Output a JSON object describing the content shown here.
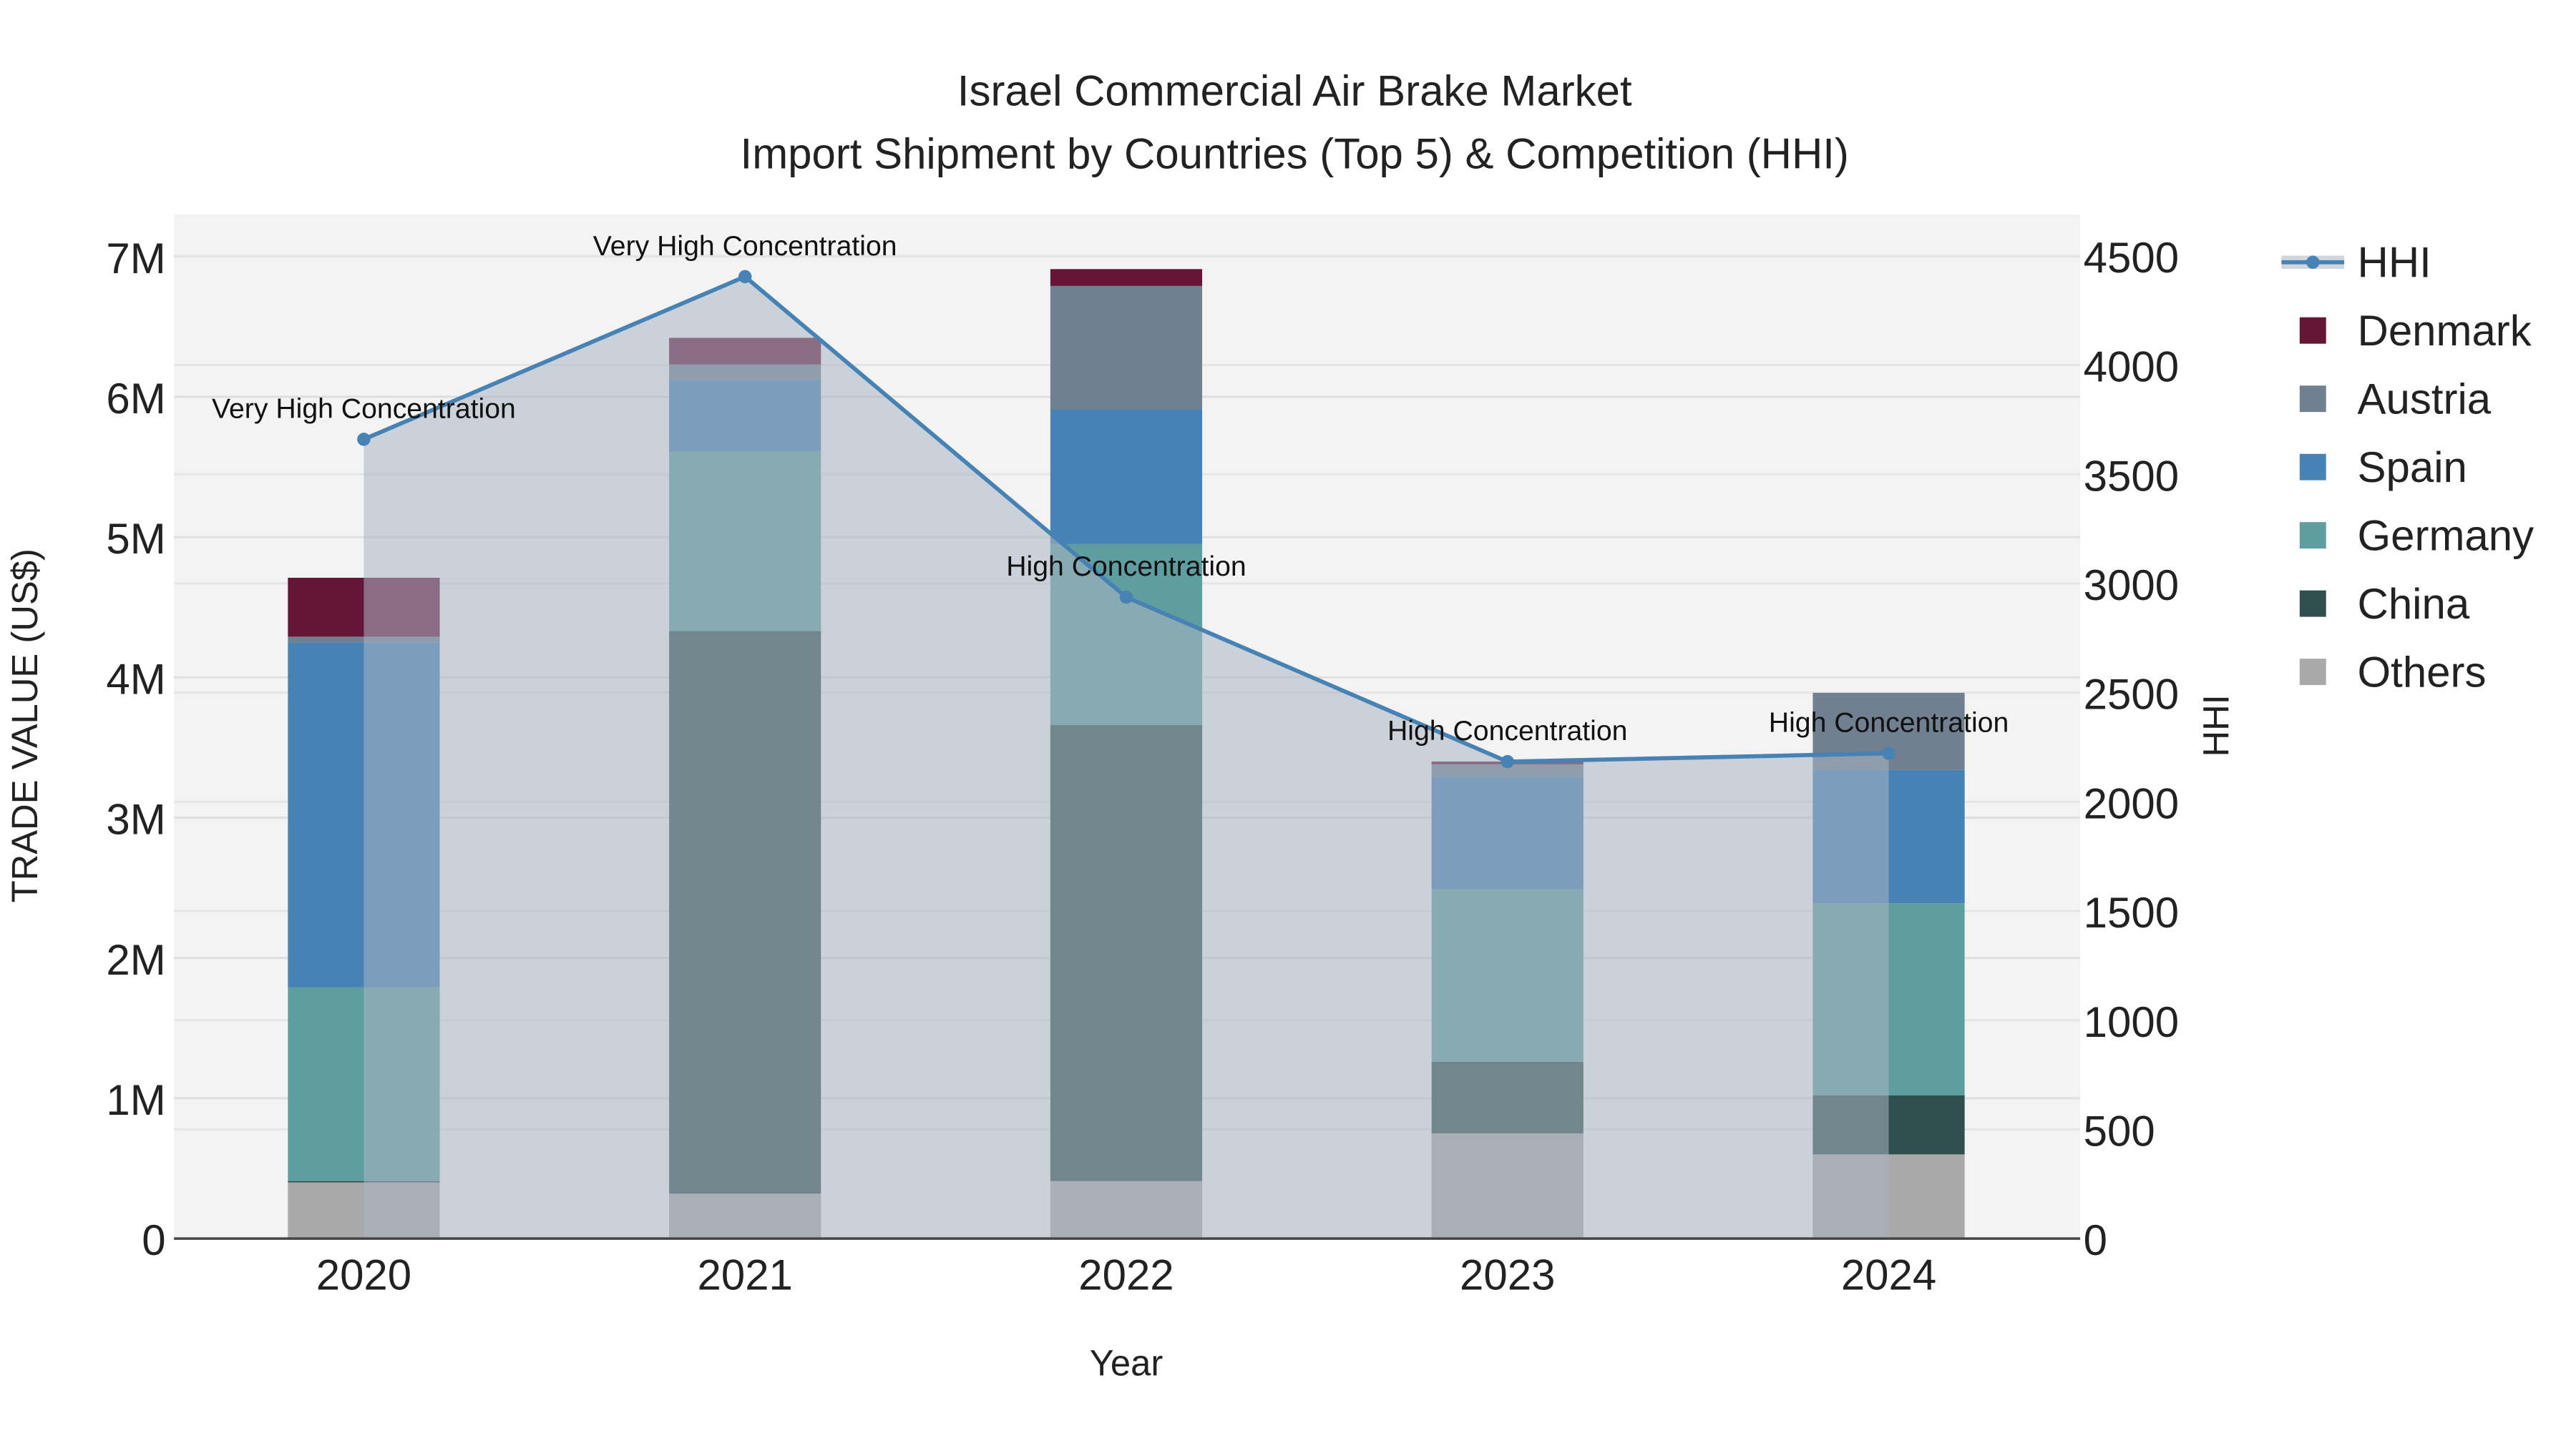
{
  "chart_data": {
    "type": "bar",
    "stacked": true,
    "title": "Israel Commercial Air Brake Market",
    "subtitle": "Import Shipment by Countries (Top 5) & Competition (HHI)",
    "xlabel": "Year",
    "ylabel": "TRADE VALUE (US$)",
    "y2label": "HHI",
    "categories": [
      "2020",
      "2021",
      "2022",
      "2023",
      "2024"
    ],
    "ylim": [
      0,
      7300000
    ],
    "y2lim": [
      0,
      4690
    ],
    "yticks": [
      {
        "v": 0,
        "label": "0"
      },
      {
        "v": 1000000,
        "label": "1M"
      },
      {
        "v": 2000000,
        "label": "2M"
      },
      {
        "v": 3000000,
        "label": "3M"
      },
      {
        "v": 4000000,
        "label": "4M"
      },
      {
        "v": 5000000,
        "label": "5M"
      },
      {
        "v": 6000000,
        "label": "6M"
      },
      {
        "v": 7000000,
        "label": "7M"
      }
    ],
    "y2ticks": [
      0,
      500,
      1000,
      1500,
      2000,
      2500,
      3000,
      3500,
      4000,
      4500
    ],
    "series": [
      {
        "name": "Others",
        "color": "#A9A9A9",
        "values": [
          400000,
          320000,
          410000,
          750000,
          600000
        ]
      },
      {
        "name": "China",
        "color": "#2F4F4F",
        "values": [
          10000,
          4010000,
          3250000,
          510000,
          420000
        ]
      },
      {
        "name": "Germany",
        "color": "#5F9EA0",
        "values": [
          1380000,
          1280000,
          1290000,
          1230000,
          1370000
        ]
      },
      {
        "name": "Spain",
        "color": "#4682B4",
        "values": [
          2460000,
          510000,
          960000,
          800000,
          950000
        ]
      },
      {
        "name": "Austria",
        "color": "#708090",
        "values": [
          40000,
          110000,
          880000,
          90000,
          550000
        ]
      },
      {
        "name": "Denmark",
        "color": "#641538",
        "values": [
          420000,
          190000,
          120000,
          20000,
          0
        ]
      }
    ],
    "line": {
      "name": "HHI",
      "color": "#4682B4",
      "values": [
        3660,
        4405,
        2937,
        2184,
        2222
      ],
      "annotations": [
        "Very High Concentration",
        "Very High Concentration",
        "High Concentration",
        "High Concentration",
        "High Concentration"
      ]
    },
    "legend": {
      "position": "right",
      "items": [
        "HHI",
        "Denmark",
        "Austria",
        "Spain",
        "Germany",
        "China",
        "Others"
      ]
    },
    "grid": true
  }
}
